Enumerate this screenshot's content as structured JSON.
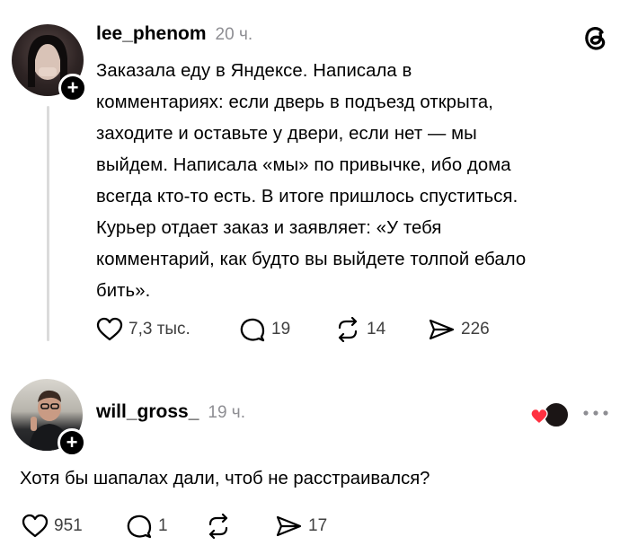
{
  "post": {
    "username": "lee_phenom",
    "time": "20 ч.",
    "text_lines": [
      "Заказала еду в Яндексе. Написала в",
      "комментариях: если дверь в подъезд открыта,",
      "заходите и оставьте у двери, если нет — мы",
      "выйдем. Написала «мы» по привычке, ибо дома",
      "всегда кто-то есть. В итоге пришлось спуститься.",
      "Курьер отдает заказ и заявляет: «У тебя",
      "комментарий, как будто вы выйдете толпой ебало",
      "бить»."
    ],
    "likes": "7,3 тыс.",
    "comments": "19",
    "reposts": "14",
    "shares": "226"
  },
  "reply": {
    "username": "will_gross_",
    "time": "19 ч.",
    "text": "Хотя бы шапалах дали, чтоб не расстраивался?",
    "likes": "951",
    "comments": "1",
    "shares": "17"
  },
  "icons": {
    "app_logo": "threads-logo-icon",
    "like": "heart-icon",
    "comment": "comment-bubble-icon",
    "repost": "repost-icon",
    "share": "send-icon",
    "more": "more-dots-icon"
  },
  "colors": {
    "text": "#000000",
    "muted": "#8e8e93",
    "heart_badge": "#ff3040"
  }
}
